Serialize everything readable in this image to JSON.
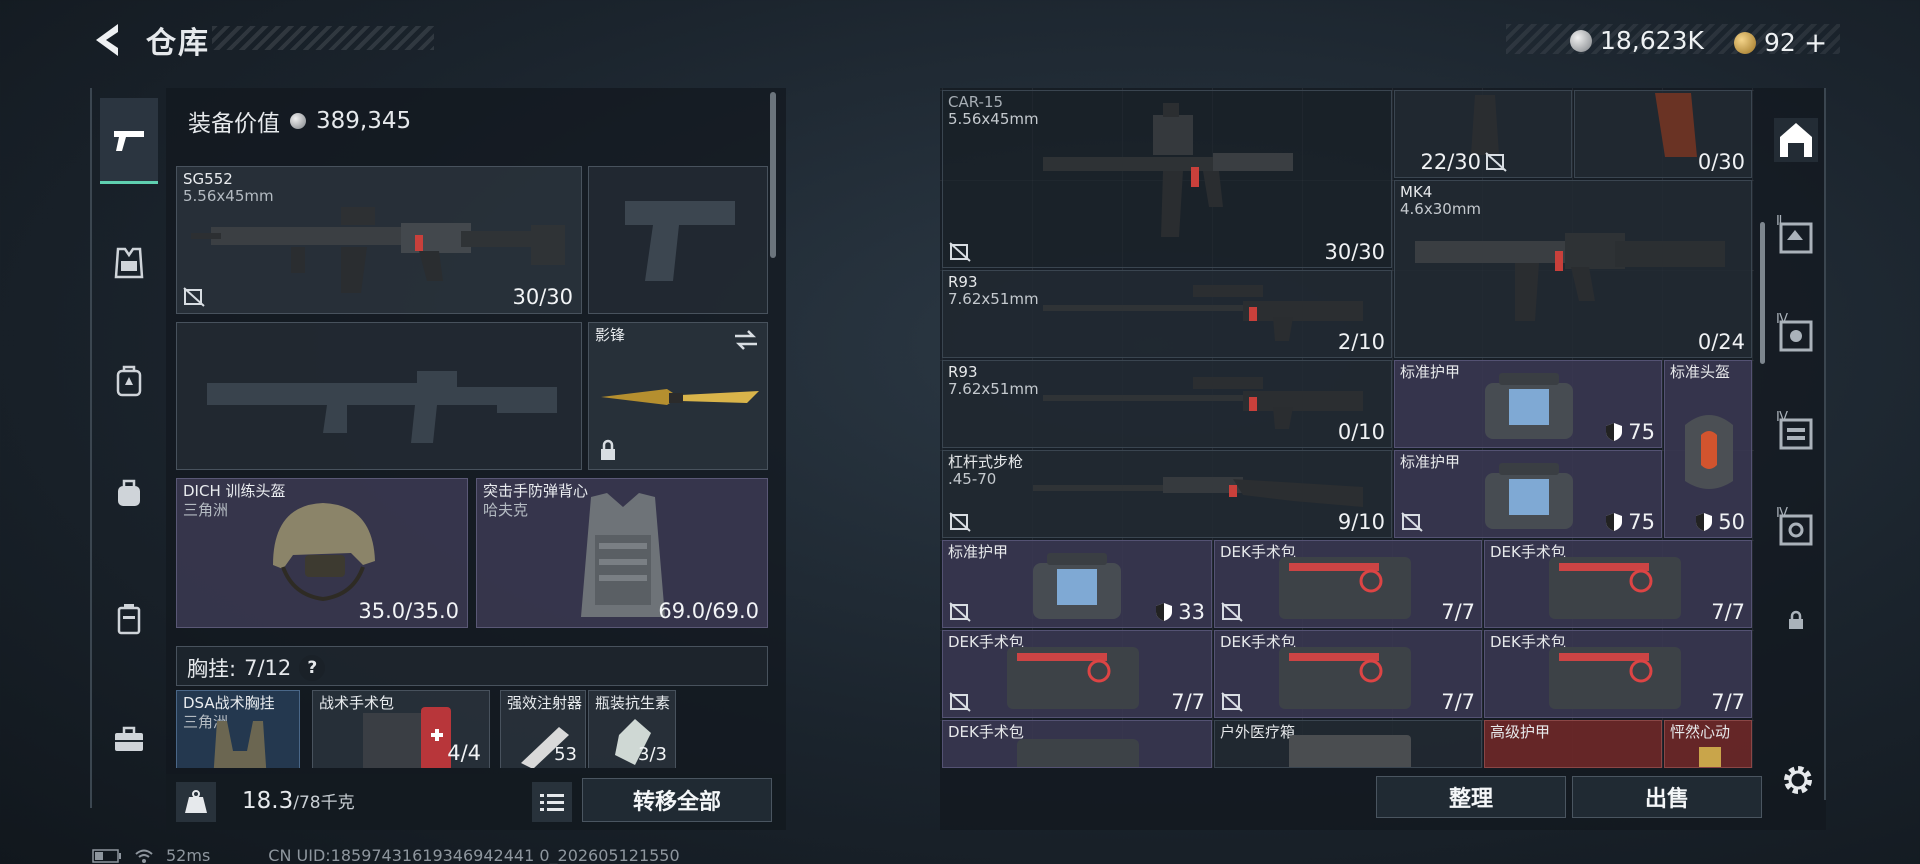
{
  "header": {
    "title": "仓库",
    "silver_amount": "18,623K",
    "gold_amount": "92",
    "add_label": "+"
  },
  "left": {
    "gear_value_label": "装备价值",
    "gear_value": "389,345",
    "primary": {
      "name": "SG552",
      "caliber": "5.56x45mm",
      "ammo": "30/30"
    },
    "melee": {
      "name": "影锋"
    },
    "helmet": {
      "name": "DICH 训练头盔",
      "faction": "三角洲",
      "durability": "35.0/35.0"
    },
    "vest": {
      "name": "突击手防弹背心",
      "faction": "哈夫克",
      "durability": "69.0/69.0"
    },
    "chest_rig": {
      "label": "胸挂:",
      "capacity": "7/12",
      "help": "?"
    },
    "rig_items": [
      {
        "name": "DSA战术胸挂",
        "sub": "三角洲",
        "count": ""
      },
      {
        "name": "战术手术包",
        "sub": "",
        "count": "4/4"
      },
      {
        "name": "强效注射器",
        "sub": "",
        "count": "53"
      },
      {
        "name": "瓶装抗生素",
        "sub": "",
        "count": "3/3"
      }
    ],
    "weight_value": "18.3",
    "weight_max": "/78千克",
    "transfer_all": "转移全部"
  },
  "grid": [
    {
      "name": "CAR-15",
      "sub": "5.56x45mm",
      "count": "30/30"
    },
    {
      "name": "",
      "sub": "",
      "count": "22/30"
    },
    {
      "name": "",
      "sub": "",
      "count": "0/30"
    },
    {
      "name": "MK4",
      "sub": "4.6x30mm",
      "count": "0/24"
    },
    {
      "name": "R93",
      "sub": "7.62x51mm",
      "count": "2/10"
    },
    {
      "name": "R93",
      "sub": "7.62x51mm",
      "count": "0/10"
    },
    {
      "name": "标准护甲",
      "sub": "",
      "count": "75"
    },
    {
      "name": "标准头盔",
      "sub": "",
      "count": "50"
    },
    {
      "name": "杠杆式步枪",
      "sub": ".45-70",
      "count": "9/10"
    },
    {
      "name": "标准护甲",
      "sub": "",
      "count": "75"
    },
    {
      "name": "标准护甲",
      "sub": "",
      "count": "33"
    },
    {
      "name": "DEK手术包",
      "sub": "",
      "count": "7/7"
    },
    {
      "name": "DEK手术包",
      "sub": "",
      "count": "7/7"
    },
    {
      "name": "DEK手术包",
      "sub": "",
      "count": "7/7"
    },
    {
      "name": "DEK手术包",
      "sub": "",
      "count": "7/7"
    },
    {
      "name": "DEK手术包",
      "sub": "",
      "count": "7/7"
    },
    {
      "name": "DEK手术包",
      "sub": "",
      "count": ""
    },
    {
      "name": "户外医疗箱",
      "sub": "",
      "count": ""
    },
    {
      "name": "高级护甲",
      "sub": "",
      "count": ""
    },
    {
      "name": "怦然心动",
      "sub": "",
      "count": ""
    }
  ],
  "actions": {
    "organize": "整理",
    "sell": "出售"
  },
  "status": {
    "ping": "52ms",
    "uid": "CN UID:18597431619346942441 0_202605121550"
  },
  "right_side_tabs": [
    "",
    "Ⅱ",
    "Ⅳ",
    "Ⅳ",
    "Ⅳ"
  ],
  "colors": {
    "accent": "#5fd0b0",
    "purple_cell": "#3a3852",
    "red_cell": "#6e2828"
  }
}
